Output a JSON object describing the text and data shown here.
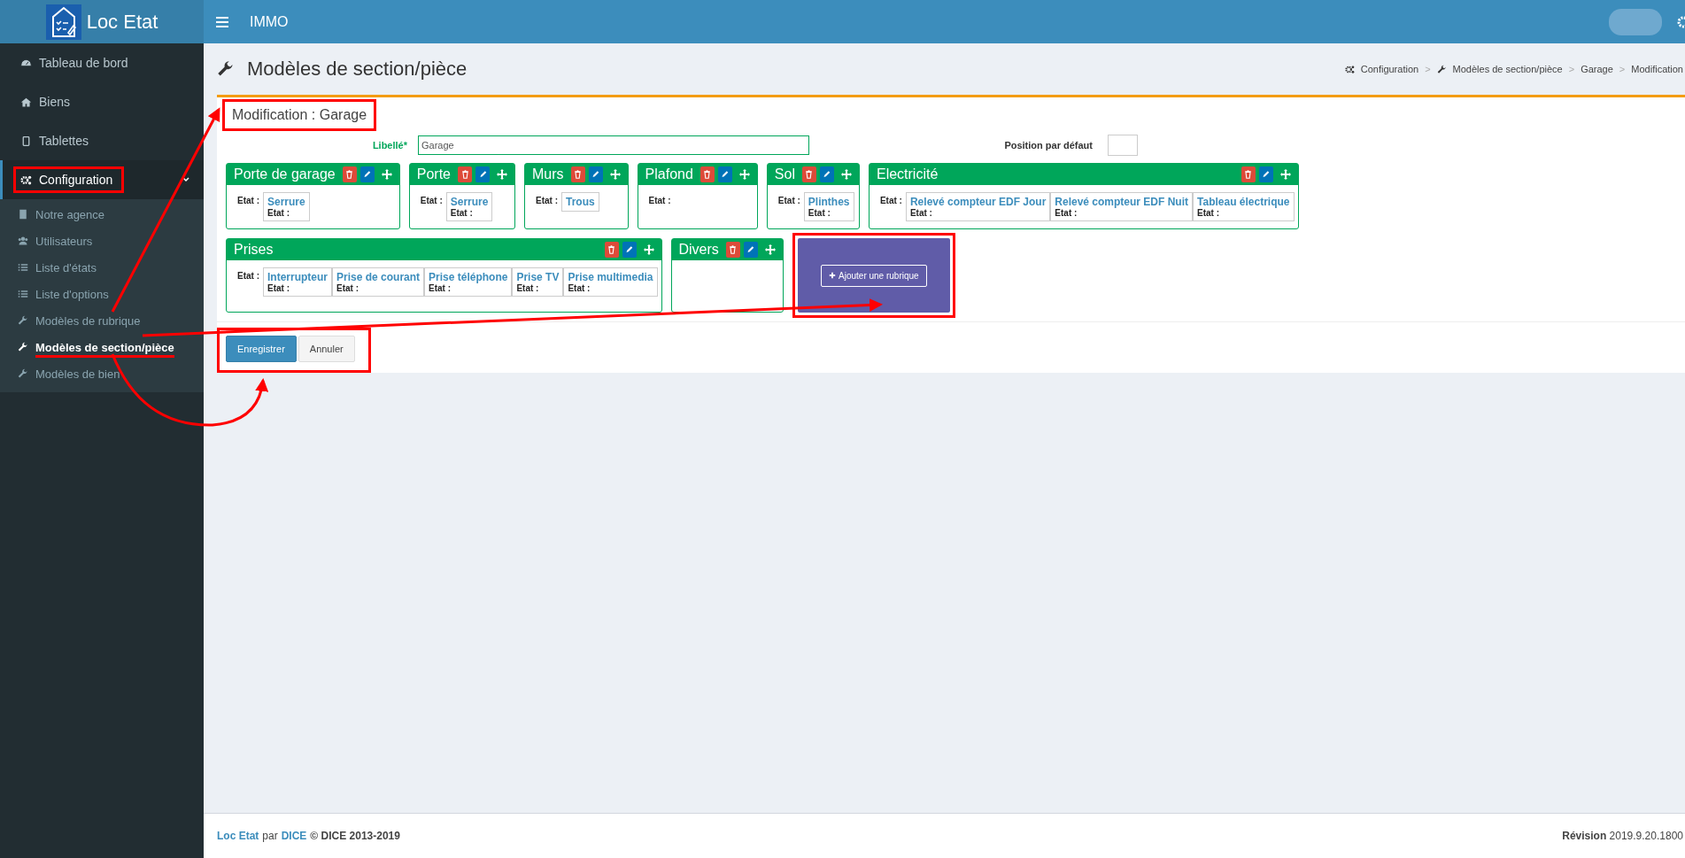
{
  "header": {
    "app_name": "Loc Etat",
    "title": "IMMO"
  },
  "sidebar": {
    "items": [
      {
        "label": "Tableau de bord",
        "selected": false,
        "highlighted": false
      },
      {
        "label": "Biens",
        "selected": false,
        "highlighted": false
      },
      {
        "label": "Tablettes",
        "selected": false,
        "highlighted": false
      },
      {
        "label": "Configuration",
        "selected": true,
        "highlighted": true,
        "expanded": true,
        "children": [
          {
            "label": "Notre agence",
            "selected": false,
            "underlined": false
          },
          {
            "label": "Utilisateurs",
            "selected": false,
            "underlined": false
          },
          {
            "label": "Liste d'états",
            "selected": false,
            "underlined": false
          },
          {
            "label": "Liste d'options",
            "selected": false,
            "underlined": false
          },
          {
            "label": "Modèles de rubrique",
            "selected": false,
            "underlined": false
          },
          {
            "label": "Modèles de section/pièce",
            "selected": true,
            "underlined": true
          },
          {
            "label": "Modèles de bien",
            "selected": false,
            "underlined": false
          }
        ]
      }
    ]
  },
  "page": {
    "title": "Modèles de section/pièce",
    "breadcrumb": [
      {
        "label": "Configuration"
      },
      {
        "label": "Modèles de section/pièce",
        "separator": ">"
      },
      {
        "label": "Garage",
        "separator": ">"
      },
      {
        "label": "Modification",
        "separator": ">"
      }
    ]
  },
  "form": {
    "title": "Modification : Garage",
    "title_highlighted": true,
    "name_label": "Libellé*",
    "name_value": "Garage",
    "position_label": "Position par défaut"
  },
  "sections": [
    {
      "title": "Porte de garage",
      "state_label": "Etat :",
      "items": [
        {
          "name": "Serrure",
          "state_label": "Etat :"
        }
      ]
    },
    {
      "title": "Porte",
      "state_label": "Etat :",
      "items": [
        {
          "name": "Serrure",
          "state_label": "Etat :"
        }
      ]
    },
    {
      "title": "Murs",
      "state_label": "Etat :",
      "items": [
        {
          "name": "Trous"
        }
      ]
    },
    {
      "title": "Plafond",
      "state_label": "Etat :"
    },
    {
      "title": "Sol",
      "state_label": "Etat :",
      "items": [
        {
          "name": "Plinthes",
          "state_label": "Etat :"
        }
      ]
    },
    {
      "title": "Electricité",
      "state_label": "Etat :",
      "items": [
        {
          "name": "Relevé compteur EDF Jour",
          "state_label": "Etat :"
        },
        {
          "name": "Relevé compteur EDF Nuit",
          "state_label": "Etat :"
        },
        {
          "name": "Tableau électrique",
          "state_label": "Etat :"
        }
      ]
    },
    {
      "title": "Prises",
      "state_label": "Etat :",
      "items": [
        {
          "name": "Interrupteur",
          "state_label": "Etat :"
        },
        {
          "name": "Prise de courant",
          "state_label": "Etat :"
        },
        {
          "name": "Prise téléphone",
          "state_label": "Etat :"
        },
        {
          "name": "Prise TV",
          "state_label": "Etat :"
        },
        {
          "name": "Prise multimedia",
          "state_label": "Etat :"
        }
      ]
    },
    {
      "title": "Divers"
    }
  ],
  "add_section": {
    "label": "Ajouter une rubrique",
    "highlighted": true
  },
  "actions": {
    "highlighted": true,
    "buttons": [
      {
        "label": "Enregistrer",
        "kind": "primary"
      },
      {
        "label": "Annuler",
        "kind": "default"
      }
    ]
  },
  "footer": {
    "brand": "Loc Etat",
    "by": "par",
    "company": "DICE",
    "copyright": "© DICE 2013-2019",
    "revision": "**Révision** 2019.9.20.1800"
  }
}
